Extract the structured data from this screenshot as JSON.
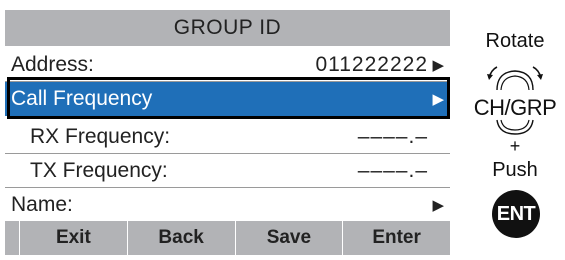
{
  "screen": {
    "title": "GROUP ID",
    "rows": [
      {
        "label": "Address:",
        "value": "011222222",
        "arrow": "▶"
      },
      {
        "label": "Call Frequency",
        "value": "",
        "arrow": "▶"
      },
      {
        "label": "RX Frequency:",
        "value": "––––.–",
        "arrow": ""
      },
      {
        "label": "TX Frequency:",
        "value": "––––.–",
        "arrow": ""
      },
      {
        "label": "Name:",
        "value": "",
        "arrow": "▶"
      }
    ],
    "softkeys": [
      "Exit",
      "Back",
      "Save",
      "Enter"
    ]
  },
  "controls": {
    "rotate_label": "Rotate",
    "knob_label": "CH/GRP",
    "plus": "+",
    "push_label": "Push",
    "ent_label": "ENT"
  },
  "colors": {
    "selection": "#1f6fb8",
    "bar_gray": "#b2b3b6"
  }
}
